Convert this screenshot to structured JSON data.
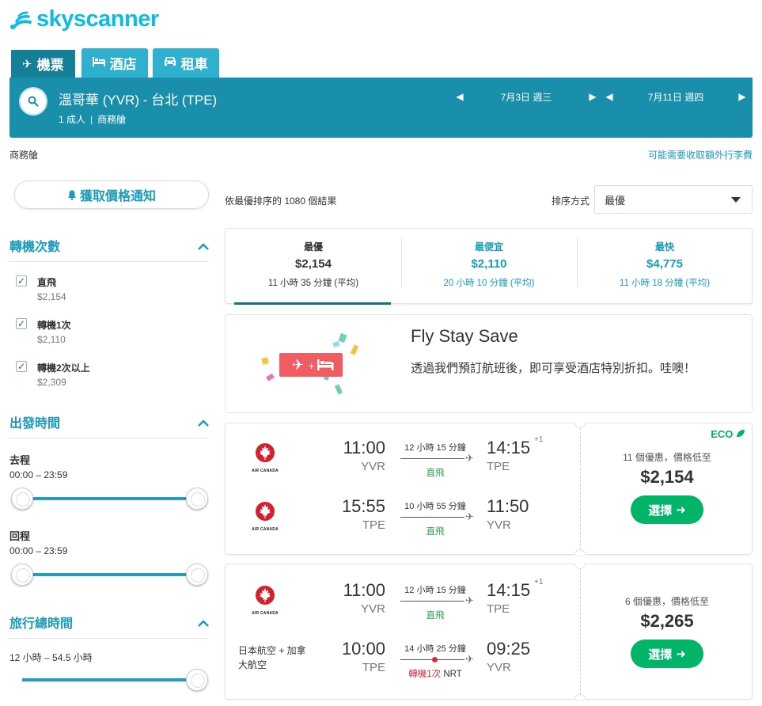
{
  "brand": {
    "name": "skyscanner",
    "color": "#0bbce5"
  },
  "tabs": [
    {
      "label": "機票",
      "icon": "plane-icon",
      "active": true
    },
    {
      "label": "酒店",
      "icon": "bed-icon",
      "active": false
    },
    {
      "label": "租車",
      "icon": "car-icon",
      "active": false
    }
  ],
  "search": {
    "route": "溫哥華 (YVR) - 台北 (TPE)",
    "passengers": "1 成人",
    "cabin": "商務艙",
    "depart_date": "7月3日 週三",
    "return_date": "7月11日 週四"
  },
  "info_bar": {
    "cabin": "商務艙",
    "baggage_note": "可能需要收取額外行李費"
  },
  "price_alert": "獲取價格通知",
  "filters": {
    "stops": {
      "title": "轉機次數",
      "options": [
        {
          "label": "直飛",
          "price": "$2,154",
          "checked": true
        },
        {
          "label": "轉機1次",
          "price": "$2,110",
          "checked": true
        },
        {
          "label": "轉機2次以上",
          "price": "$2,309",
          "checked": true
        }
      ]
    },
    "departure_times": {
      "title": "出發時間",
      "outbound_label": "去程",
      "outbound_range": "00:00 – 23:59",
      "return_label": "回程",
      "return_range": "00:00 – 23:59"
    },
    "journey_duration": {
      "title": "旅行總時間",
      "range": "12 小時 – 54.5 小時"
    }
  },
  "results": {
    "count_text": "依最優排序的 1080 個結果",
    "sort_label": "排序方式",
    "sort_value": "最優"
  },
  "sort_tabs": [
    {
      "title": "最優",
      "price": "$2,154",
      "duration": "11 小時 35 分鐘 (平均)",
      "active": true
    },
    {
      "title": "最便宜",
      "price": "$2,110",
      "duration": "20 小時 10 分鐘 (平均)",
      "active": false
    },
    {
      "title": "最快",
      "price": "$4,775",
      "duration": "11 小時 18 分鐘 (平均)",
      "active": false
    }
  ],
  "promo": {
    "title": "Fly Stay Save",
    "text": "透過我們預訂航班後，即可享受酒店特別折扣。哇噢！"
  },
  "flights": [
    {
      "eco": "ECO",
      "deals": "11 個優惠，價格低至",
      "price": "$2,154",
      "select": "選擇",
      "legs": [
        {
          "airline": "AIR CANADA",
          "dep_time": "11:00",
          "dep_code": "YVR",
          "duration": "12 小時 15 分鐘",
          "stops": "直飛",
          "arr_time": "14:15",
          "arr_code": "TPE",
          "plus_days": "+1"
        },
        {
          "airline": "AIR CANADA",
          "dep_time": "15:55",
          "dep_code": "TPE",
          "duration": "10 小時 55 分鐘",
          "stops": "直飛",
          "arr_time": "11:50",
          "arr_code": "YVR",
          "plus_days": ""
        }
      ]
    },
    {
      "eco": "",
      "deals": "6 個優惠，價格低至",
      "price": "$2,265",
      "select": "選擇",
      "legs": [
        {
          "airline": "AIR CANADA",
          "dep_time": "11:00",
          "dep_code": "YVR",
          "duration": "12 小時 15 分鐘",
          "stops": "直飛",
          "arr_time": "14:15",
          "arr_code": "TPE",
          "plus_days": "+1"
        },
        {
          "airline_text": "日本航空 + 加拿大航空",
          "dep_time": "10:00",
          "dep_code": "TPE",
          "duration": "14 小時 25 分鐘",
          "stops": "轉機1次",
          "via": "NRT",
          "arr_time": "09:25",
          "arr_code": "YVR",
          "plus_days": ""
        }
      ]
    }
  ],
  "colors": {
    "primary": "#1a8fab",
    "accent": "#1a9bba",
    "cta": "#00b46a",
    "stop": "#d62b3a"
  }
}
